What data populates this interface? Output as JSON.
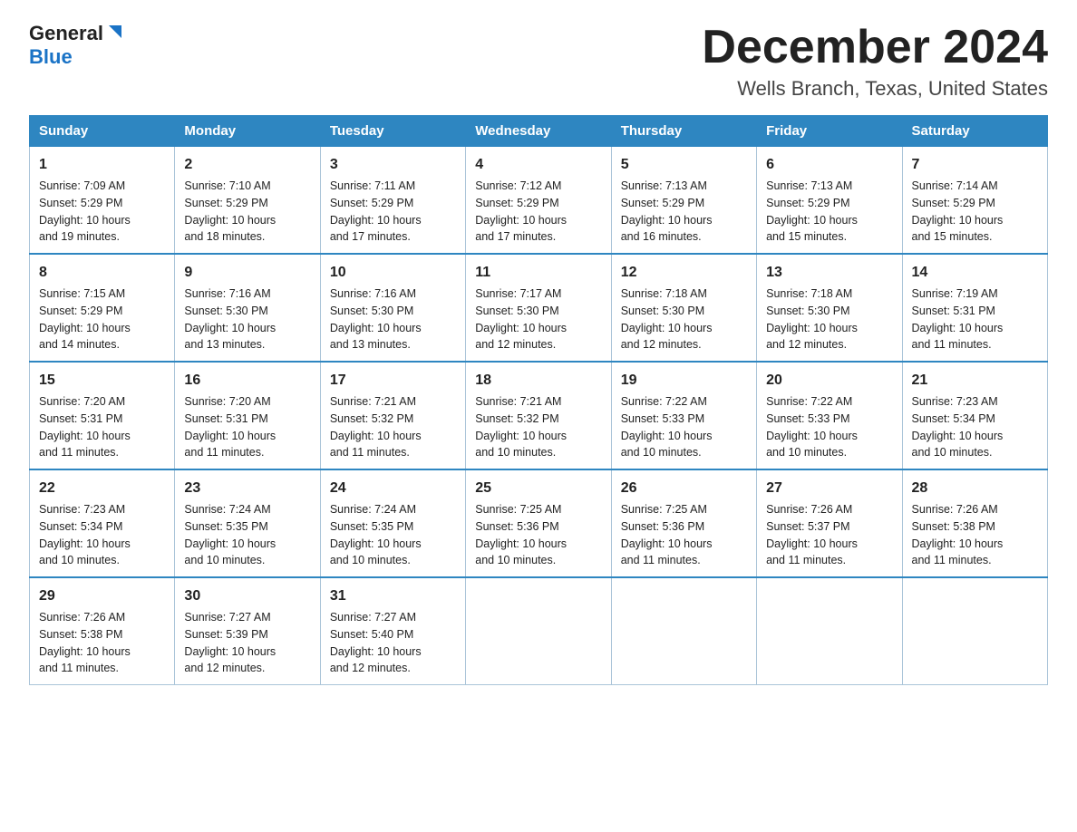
{
  "logo": {
    "general": "General",
    "blue": "Blue"
  },
  "header": {
    "month": "December 2024",
    "location": "Wells Branch, Texas, United States"
  },
  "days_of_week": [
    "Sunday",
    "Monday",
    "Tuesday",
    "Wednesday",
    "Thursday",
    "Friday",
    "Saturday"
  ],
  "weeks": [
    [
      {
        "day": 1,
        "info": "Sunrise: 7:09 AM\nSunset: 5:29 PM\nDaylight: 10 hours\nand 19 minutes."
      },
      {
        "day": 2,
        "info": "Sunrise: 7:10 AM\nSunset: 5:29 PM\nDaylight: 10 hours\nand 18 minutes."
      },
      {
        "day": 3,
        "info": "Sunrise: 7:11 AM\nSunset: 5:29 PM\nDaylight: 10 hours\nand 17 minutes."
      },
      {
        "day": 4,
        "info": "Sunrise: 7:12 AM\nSunset: 5:29 PM\nDaylight: 10 hours\nand 17 minutes."
      },
      {
        "day": 5,
        "info": "Sunrise: 7:13 AM\nSunset: 5:29 PM\nDaylight: 10 hours\nand 16 minutes."
      },
      {
        "day": 6,
        "info": "Sunrise: 7:13 AM\nSunset: 5:29 PM\nDaylight: 10 hours\nand 15 minutes."
      },
      {
        "day": 7,
        "info": "Sunrise: 7:14 AM\nSunset: 5:29 PM\nDaylight: 10 hours\nand 15 minutes."
      }
    ],
    [
      {
        "day": 8,
        "info": "Sunrise: 7:15 AM\nSunset: 5:29 PM\nDaylight: 10 hours\nand 14 minutes."
      },
      {
        "day": 9,
        "info": "Sunrise: 7:16 AM\nSunset: 5:30 PM\nDaylight: 10 hours\nand 13 minutes."
      },
      {
        "day": 10,
        "info": "Sunrise: 7:16 AM\nSunset: 5:30 PM\nDaylight: 10 hours\nand 13 minutes."
      },
      {
        "day": 11,
        "info": "Sunrise: 7:17 AM\nSunset: 5:30 PM\nDaylight: 10 hours\nand 12 minutes."
      },
      {
        "day": 12,
        "info": "Sunrise: 7:18 AM\nSunset: 5:30 PM\nDaylight: 10 hours\nand 12 minutes."
      },
      {
        "day": 13,
        "info": "Sunrise: 7:18 AM\nSunset: 5:30 PM\nDaylight: 10 hours\nand 12 minutes."
      },
      {
        "day": 14,
        "info": "Sunrise: 7:19 AM\nSunset: 5:31 PM\nDaylight: 10 hours\nand 11 minutes."
      }
    ],
    [
      {
        "day": 15,
        "info": "Sunrise: 7:20 AM\nSunset: 5:31 PM\nDaylight: 10 hours\nand 11 minutes."
      },
      {
        "day": 16,
        "info": "Sunrise: 7:20 AM\nSunset: 5:31 PM\nDaylight: 10 hours\nand 11 minutes."
      },
      {
        "day": 17,
        "info": "Sunrise: 7:21 AM\nSunset: 5:32 PM\nDaylight: 10 hours\nand 11 minutes."
      },
      {
        "day": 18,
        "info": "Sunrise: 7:21 AM\nSunset: 5:32 PM\nDaylight: 10 hours\nand 10 minutes."
      },
      {
        "day": 19,
        "info": "Sunrise: 7:22 AM\nSunset: 5:33 PM\nDaylight: 10 hours\nand 10 minutes."
      },
      {
        "day": 20,
        "info": "Sunrise: 7:22 AM\nSunset: 5:33 PM\nDaylight: 10 hours\nand 10 minutes."
      },
      {
        "day": 21,
        "info": "Sunrise: 7:23 AM\nSunset: 5:34 PM\nDaylight: 10 hours\nand 10 minutes."
      }
    ],
    [
      {
        "day": 22,
        "info": "Sunrise: 7:23 AM\nSunset: 5:34 PM\nDaylight: 10 hours\nand 10 minutes."
      },
      {
        "day": 23,
        "info": "Sunrise: 7:24 AM\nSunset: 5:35 PM\nDaylight: 10 hours\nand 10 minutes."
      },
      {
        "day": 24,
        "info": "Sunrise: 7:24 AM\nSunset: 5:35 PM\nDaylight: 10 hours\nand 10 minutes."
      },
      {
        "day": 25,
        "info": "Sunrise: 7:25 AM\nSunset: 5:36 PM\nDaylight: 10 hours\nand 10 minutes."
      },
      {
        "day": 26,
        "info": "Sunrise: 7:25 AM\nSunset: 5:36 PM\nDaylight: 10 hours\nand 11 minutes."
      },
      {
        "day": 27,
        "info": "Sunrise: 7:26 AM\nSunset: 5:37 PM\nDaylight: 10 hours\nand 11 minutes."
      },
      {
        "day": 28,
        "info": "Sunrise: 7:26 AM\nSunset: 5:38 PM\nDaylight: 10 hours\nand 11 minutes."
      }
    ],
    [
      {
        "day": 29,
        "info": "Sunrise: 7:26 AM\nSunset: 5:38 PM\nDaylight: 10 hours\nand 11 minutes."
      },
      {
        "day": 30,
        "info": "Sunrise: 7:27 AM\nSunset: 5:39 PM\nDaylight: 10 hours\nand 12 minutes."
      },
      {
        "day": 31,
        "info": "Sunrise: 7:27 AM\nSunset: 5:40 PM\nDaylight: 10 hours\nand 12 minutes."
      },
      null,
      null,
      null,
      null
    ]
  ]
}
